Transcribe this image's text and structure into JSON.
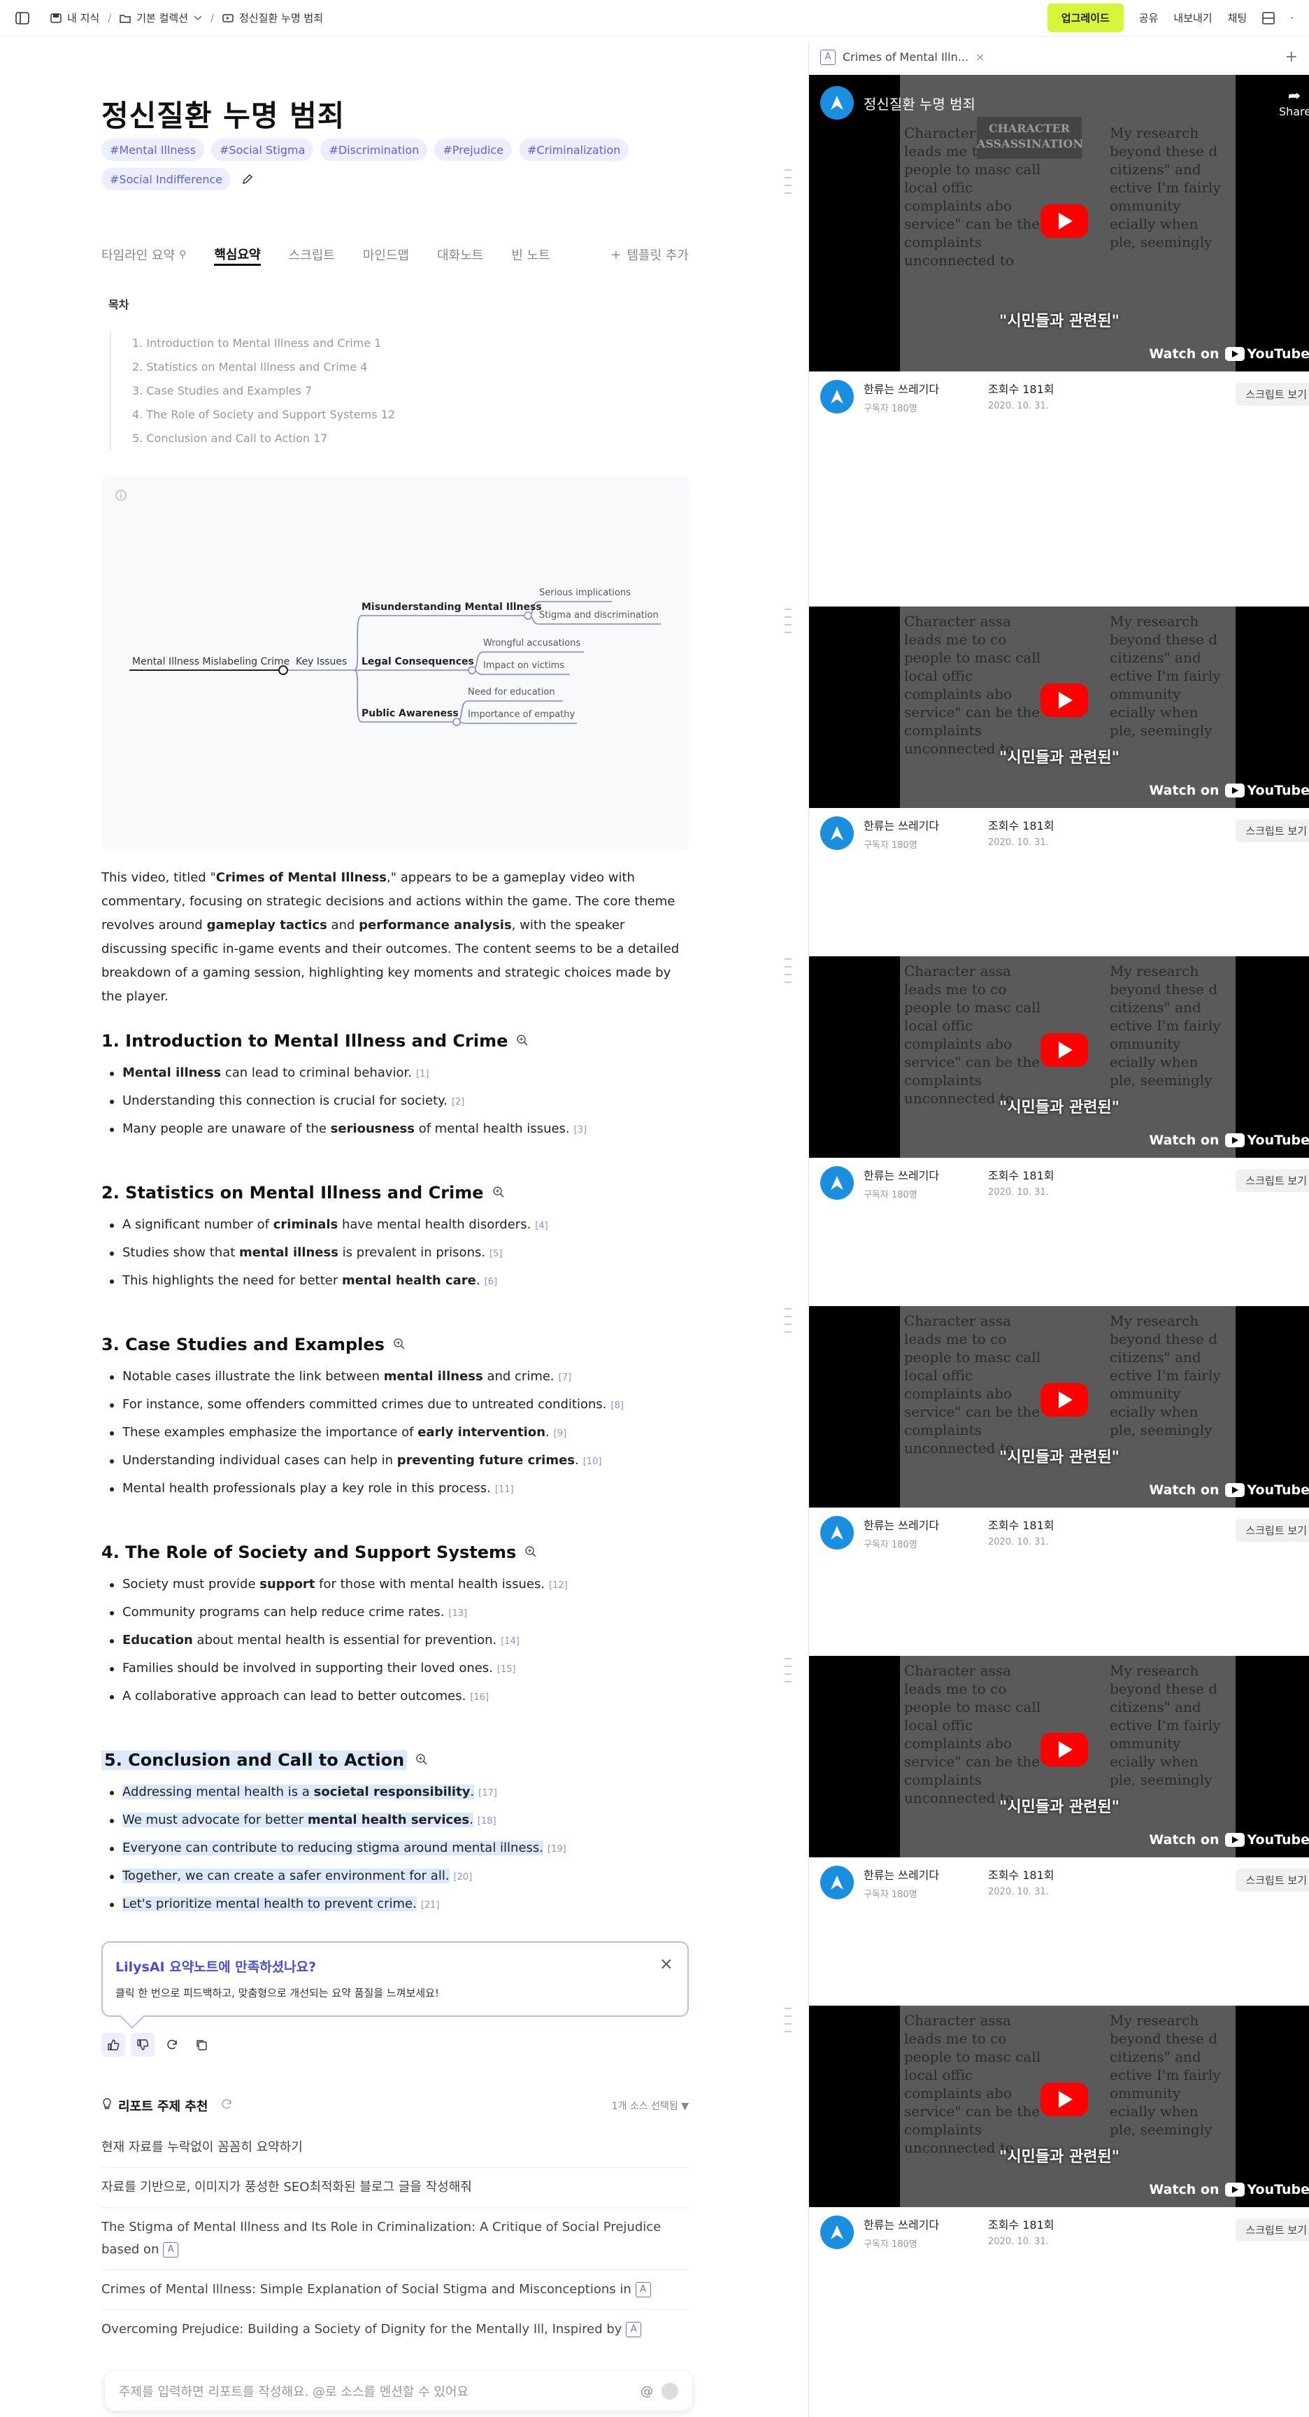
{
  "topbar": {
    "crumb_root": "내 지식",
    "crumb_collection": "기본 컬렉션",
    "crumb_page": "정신질환 누명 범죄",
    "upgrade": "업그레이드",
    "share": "공유",
    "export": "내보내기",
    "chat": "채팅"
  },
  "doc": {
    "title": "정신질환 누명 범죄",
    "tags": [
      "#Mental Illness",
      "#Social Stigma",
      "#Discrimination",
      "#Prejudice",
      "#Criminalization",
      "#Social Indifference"
    ],
    "tabs": [
      "타임라인 요약",
      "핵심요약",
      "스크립트",
      "마인드맵",
      "대화노트",
      "빈 노트"
    ],
    "add_template": "템플릿 추가",
    "toc_title": "목차",
    "toc": [
      "1. Introduction to Mental Illness and Crime 1",
      "2. Statistics on Mental Illness and Crime 4",
      "3. Case Studies and Examples 7",
      "4. The Role of Society and Support Systems 12",
      "5. Conclusion and Call to Action 17"
    ],
    "mindmap": {
      "root": "Mental Illness Mislabeling Crime",
      "mid": "Key Issues",
      "branches": [
        {
          "label": "Misunderstanding Mental Illness",
          "leaves": [
            "Serious implications",
            "Stigma and discrimination"
          ]
        },
        {
          "label": "Legal Consequences",
          "leaves": [
            "Wrongful accusations",
            "Impact on victims"
          ]
        },
        {
          "label": "Public Awareness",
          "leaves": [
            "Need for education",
            "Importance of empathy"
          ]
        }
      ]
    },
    "intro": {
      "p1": "This video, titled \"",
      "b1": "Crimes of Mental Illness",
      "p2": ",\" appears to be a gameplay video with commentary, focusing on strategic decisions and actions within the game. The core theme revolves around ",
      "b2": "gameplay tactics",
      "p3": " and ",
      "b3": "performance analysis",
      "p4": ", with the speaker discussing specific in-game events and their outcomes. The content seems to be a detailed breakdown of a gaming session, highlighting key moments and strategic choices made by the player."
    },
    "sections": [
      {
        "title": "1. Introduction to Mental Illness and Crime",
        "items": [
          {
            "pre": "",
            "b": "Mental illness",
            "post": " can lead to criminal behavior.",
            "ref": "[1]"
          },
          {
            "pre": "Understanding this connection is crucial for society.",
            "b": "",
            "post": "",
            "ref": "[2]"
          },
          {
            "pre": "Many people are unaware of the ",
            "b": "seriousness",
            "post": " of mental health issues.",
            "ref": "[3]"
          }
        ]
      },
      {
        "title": "2. Statistics on Mental Illness and Crime",
        "items": [
          {
            "pre": "A significant number of ",
            "b": "criminals",
            "post": " have mental health disorders.",
            "ref": "[4]"
          },
          {
            "pre": "Studies show that ",
            "b": "mental illness",
            "post": " is prevalent in prisons.",
            "ref": "[5]"
          },
          {
            "pre": "This highlights the need for better ",
            "b": "mental health care",
            "post": ".",
            "ref": "[6]"
          }
        ]
      },
      {
        "title": "3. Case Studies and Examples",
        "items": [
          {
            "pre": "Notable cases illustrate the link between ",
            "b": "mental illness",
            "post": " and crime.",
            "ref": "[7]"
          },
          {
            "pre": "For instance, some offenders committed crimes due to untreated conditions.",
            "b": "",
            "post": "",
            "ref": "[8]"
          },
          {
            "pre": "These examples emphasize the importance of ",
            "b": "early intervention",
            "post": ".",
            "ref": "[9]"
          },
          {
            "pre": "Understanding individual cases can help in ",
            "b": "preventing future crimes",
            "post": ".",
            "ref": "[10]"
          },
          {
            "pre": "Mental health professionals play a key role in this process.",
            "b": "",
            "post": "",
            "ref": "[11]"
          }
        ]
      },
      {
        "title": "4. The Role of Society and Support Systems",
        "items": [
          {
            "pre": "Society must provide ",
            "b": "support",
            "post": " for those with mental health issues.",
            "ref": "[12]"
          },
          {
            "pre": "Community programs can help reduce crime rates.",
            "b": "",
            "post": "",
            "ref": "[13]"
          },
          {
            "pre": "",
            "b": "Education",
            "post": " about mental health is essential for prevention.",
            "ref": "[14]"
          },
          {
            "pre": "Families should be involved in supporting their loved ones.",
            "b": "",
            "post": "",
            "ref": "[15]"
          },
          {
            "pre": "A collaborative approach can lead to better outcomes.",
            "b": "",
            "post": "",
            "ref": "[16]"
          }
        ]
      },
      {
        "title": "5. Conclusion and Call to Action",
        "items": [
          {
            "pre": "Addressing mental health is a ",
            "b": "societal responsibility",
            "post": ".",
            "ref": "[17]"
          },
          {
            "pre": "We must advocate for better ",
            "b": "mental health services",
            "post": ".",
            "ref": "[18]"
          },
          {
            "pre": "Everyone can contribute to reducing stigma around mental illness.",
            "b": "",
            "post": "",
            "ref": "[19]"
          },
          {
            "pre": "Together, we can create a safer environment for all.",
            "b": "",
            "post": "",
            "ref": "[20]"
          },
          {
            "pre": "Let's prioritize mental health to prevent crime.",
            "b": "",
            "post": "",
            "ref": "[21]"
          }
        ]
      }
    ],
    "feedback": {
      "title": "LilysAI 요약노트에 만족하셨나요?",
      "sub": "클릭 한 번으로 피드백하고, 맞춤형으로 개선되는 요약 품질을 느껴보세요!"
    },
    "report": {
      "head": "리포트 주제 추천",
      "source": "1개 소스 선택됨",
      "items": [
        "현재 자료를 누락없이 꼼꼼히 요약하기",
        "자료를 기반으로, 이미지가 풍성한 SEO최적화된 블로그 글을 작성해줘",
        "The Stigma of Mental Illness and Its Role in Criminalization: A Critique of Social Prejudice based on",
        "Crimes of Mental Illness: Simple Explanation of Social Stigma and Misconceptions in",
        "Overcoming Prejudice: Building a Society of Dignity for the Mentally Ill, Inspired by"
      ],
      "source_badge": "A"
    },
    "chat_placeholder": "주제를 입력하면 리포트를 작성해요. @로 소스를 멘션할 수 있어요",
    "chat_at": "@"
  },
  "right": {
    "tab_label": "Crimes of Mental Illn...",
    "tab_badge": "A",
    "video_title": "정신질환 누명 범죄",
    "share": "Share",
    "char_title": "CHARACTER ASSASSINATION",
    "caption": "\"시민들과 관련된\"",
    "watch_on": "Watch on",
    "youtube": "YouTube",
    "poster_left": "Character assa leads me to co people to masc call local offic complaints abo service\" can be the complaints unconnected to",
    "poster_right": "My research beyond these d citizens\" and ective I'm fairly ommunity ecially when ple, seemingly",
    "channel": "한류는 쓰레기다",
    "subscribers": "구독자 180명",
    "views": "조회수 181회",
    "date": "2020. 10. 31.",
    "script_btn": "스크립트 보기"
  }
}
